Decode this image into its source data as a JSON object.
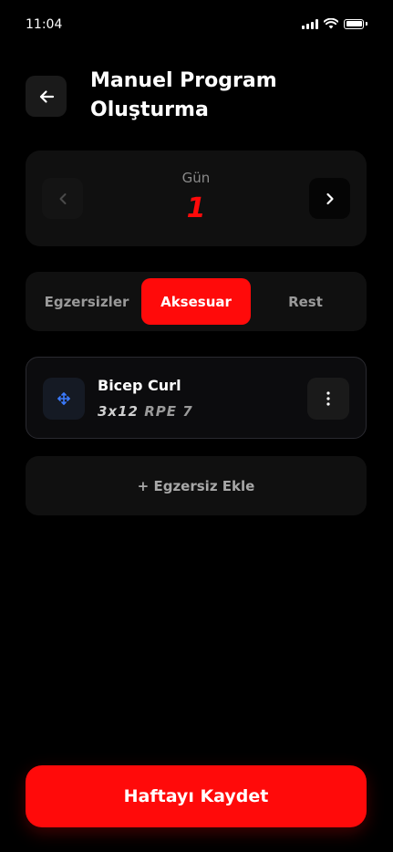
{
  "status": {
    "time": "11:04"
  },
  "header": {
    "title": "Manuel Program Oluşturma"
  },
  "day_selector": {
    "label": "Gün",
    "value": "1"
  },
  "tabs": [
    {
      "label": "Egzersizler",
      "active": false
    },
    {
      "label": "Aksesuar",
      "active": true
    },
    {
      "label": "Rest",
      "active": false
    }
  ],
  "exercise": {
    "name": "Bicep Curl",
    "sets": "3x12",
    "rpe": "RPE 7"
  },
  "add_exercise": {
    "label": "+ Egzersiz Ekle"
  },
  "save": {
    "label": "Haftayı Kaydet"
  },
  "colors": {
    "accent": "#ff0a0a",
    "background": "#000000",
    "card": "#101010"
  }
}
